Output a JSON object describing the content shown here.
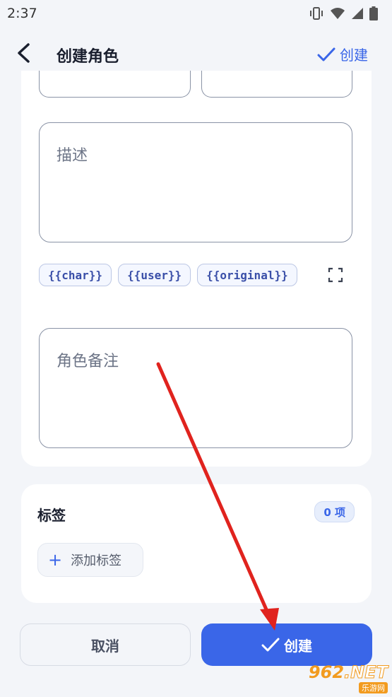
{
  "status_bar": {
    "time": "2:37",
    "icons": [
      "vibrate-icon",
      "wifi-icon",
      "signal-icon",
      "battery-icon"
    ]
  },
  "app_bar": {
    "title": "创建角色",
    "create_label": "创建"
  },
  "form": {
    "description_placeholder": "描述",
    "chips": [
      "{{char}}",
      "{{user}}",
      "{{original}}"
    ],
    "notes_placeholder": "角色备注"
  },
  "tags": {
    "title": "标签",
    "count": "0 项",
    "add_label": "添加标签"
  },
  "buttons": {
    "cancel": "取消",
    "create": "创建"
  },
  "watermark": {
    "logo_digits": "962",
    "logo_suffix": ".NET",
    "subtitle": "乐游网"
  },
  "colors": {
    "accent": "#3a66e8",
    "annotation_arrow": "#e0231e"
  }
}
